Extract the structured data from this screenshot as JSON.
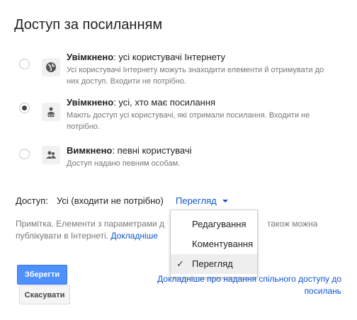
{
  "title": "Доступ за посиланням",
  "options": [
    {
      "head_bold": "Увімкнено",
      "head_rest": ": усі користувачі Інтернету",
      "desc_line1": "Усі користувачі Інтернету можуть знаходити елементи й отримувати до",
      "desc_line2": "них доступ. Входити не потрібно.",
      "icon": "globe-icon",
      "checked": false
    },
    {
      "head_bold": "Увімкнено",
      "head_rest": ": усі, хто має посилання",
      "desc_line1": "Мають доступ усі користувачі, які отримали посилання. Входити не",
      "desc_line2": "потрібно.",
      "icon": "person-link-icon",
      "checked": true
    },
    {
      "head_bold": "Вимкнено",
      "head_rest": ": певні користувачі",
      "desc_line1": "Доступ надано певним особам.",
      "desc_line2": "",
      "icon": "people-icon",
      "checked": false
    }
  ],
  "access": {
    "label": "Доступ:",
    "value": "Усі (входити не потрібно)",
    "selected": "Перегляд"
  },
  "note": {
    "text_part1": "Примітка. Елементи з параметрами д",
    "text_part1b": "також можна",
    "text_part2": "публікувати в Інтернеті.",
    "link": "Докладніше"
  },
  "menu": {
    "items": [
      "Редагування",
      "Коментування",
      "Перегляд"
    ],
    "selected_index": 2,
    "check_glyph": "✓"
  },
  "buttons": {
    "save": "Зберегти",
    "cancel": "Скасувати"
  },
  "help_link": "Докладніше про надання спільного доступу до посилань",
  "colors": {
    "accent": "#4d90fe",
    "link": "#1155cc"
  }
}
